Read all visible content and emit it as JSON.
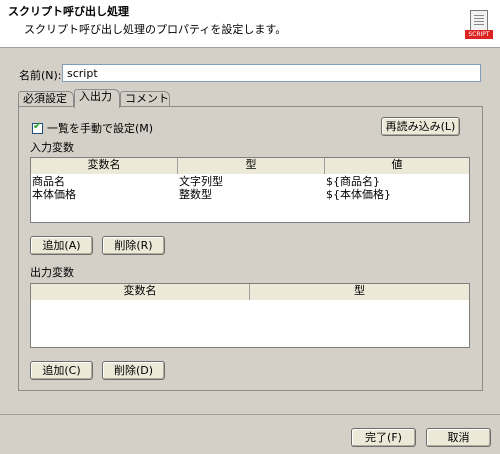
{
  "header": {
    "title": "スクリプト呼び出し処理",
    "subtitle": "スクリプト呼び出し処理のプロパティを設定します。",
    "icon": "script-icon",
    "icon_tag": "SCRIPT"
  },
  "name_field": {
    "label": "名前(N):",
    "value": "script"
  },
  "tabs": [
    {
      "label": "必須設定",
      "active": false
    },
    {
      "label": "入出力",
      "active": true
    },
    {
      "label": "コメント",
      "active": false
    }
  ],
  "manual_checkbox": {
    "label": "一覧を手動で設定(M)",
    "checked": true
  },
  "reload_button": "再読み込み(L)",
  "input_vars": {
    "label": "入力変数",
    "columns": [
      "変数名",
      "型",
      "値"
    ],
    "rows": [
      [
        "商品名",
        "文字列型",
        "${商品名}"
      ],
      [
        "本体価格",
        "整数型",
        "${本体価格}"
      ]
    ],
    "add_button": "追加(A)",
    "delete_button": "削除(R)"
  },
  "output_vars": {
    "label": "出力変数",
    "columns": [
      "変数名",
      "型"
    ],
    "rows": [],
    "add_button": "追加(C)",
    "delete_button": "削除(D)"
  },
  "footer": {
    "ok_button": "完了(F)",
    "cancel_button": "取消"
  }
}
